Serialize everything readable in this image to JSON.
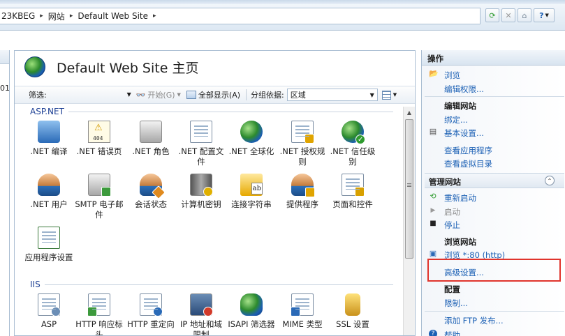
{
  "breadcrumb": {
    "items": [
      "23KBEG",
      "网站",
      "Default Web Site"
    ],
    "separator": "▸"
  },
  "toolbar": {
    "help_label": "?"
  },
  "left_panel": {
    "cut_text": "01"
  },
  "main": {
    "title": "Default Web Site 主页",
    "filter": {
      "label": "筛选:",
      "go_label": "开始(G)",
      "show_all_label": "全部显示(A)",
      "group_by_label": "分组依据:",
      "group_by_value": "区域"
    },
    "groups": [
      {
        "name": "ASP.NET",
        "tiles": [
          {
            "label": ".NET 编译",
            "icon": "download-arrow-icon"
          },
          {
            "label": ".NET 错误页",
            "icon": "error-404-icon"
          },
          {
            "label": ".NET 角色",
            "icon": "roles-icon"
          },
          {
            "label": ".NET 配置文件",
            "icon": "profile-icon"
          },
          {
            "label": ".NET 全球化",
            "icon": "globe-icon"
          },
          {
            "label": ".NET 授权规则",
            "icon": "authorization-icon"
          },
          {
            "label": ".NET 信任级别",
            "icon": "trust-level-icon"
          },
          {
            "label": ".NET 用户",
            "icon": "users-icon"
          },
          {
            "label": "SMTP 电子邮件",
            "icon": "smtp-email-icon"
          },
          {
            "label": "会话状态",
            "icon": "session-state-icon"
          },
          {
            "label": "计算机密钥",
            "icon": "machine-key-icon"
          },
          {
            "label": "连接字符串",
            "icon": "connection-string-icon"
          },
          {
            "label": "提供程序",
            "icon": "providers-icon"
          },
          {
            "label": "页面和控件",
            "icon": "pages-controls-icon"
          },
          {
            "label": "应用程序设置",
            "icon": "app-settings-icon"
          }
        ]
      },
      {
        "name": "IIS",
        "tiles": [
          {
            "label": "ASP",
            "icon": "asp-icon"
          },
          {
            "label": "HTTP 响应标头",
            "icon": "http-headers-icon"
          },
          {
            "label": "HTTP 重定向",
            "icon": "http-redirect-icon"
          },
          {
            "label": "IP 地址和域限制",
            "icon": "ip-restrictions-icon"
          },
          {
            "label": "ISAPI 筛选器",
            "icon": "isapi-filter-icon"
          },
          {
            "label": "MIME 类型",
            "icon": "mime-types-icon"
          },
          {
            "label": "SSL 设置",
            "icon": "ssl-lock-icon"
          }
        ]
      }
    ]
  },
  "actions": {
    "header": "操作",
    "items": [
      {
        "text": "浏览",
        "kind": "link",
        "icon": "explore-icon"
      },
      {
        "text": "编辑权限...",
        "kind": "link"
      },
      {
        "text": "编辑网站",
        "kind": "section"
      },
      {
        "text": "绑定...",
        "kind": "link"
      },
      {
        "text": "基本设置...",
        "kind": "link",
        "icon": "settings-icon"
      },
      {
        "text": "查看应用程序",
        "kind": "link"
      },
      {
        "text": "查看虚拟目录",
        "kind": "link"
      },
      {
        "text": "管理网站",
        "kind": "sectionbar"
      },
      {
        "text": "重新启动",
        "kind": "link",
        "icon": "restart-icon"
      },
      {
        "text": "启动",
        "kind": "dim",
        "icon": "start-icon"
      },
      {
        "text": "停止",
        "kind": "link",
        "icon": "stop-icon"
      },
      {
        "text": "浏览网站",
        "kind": "section"
      },
      {
        "text": "浏览 *:80 (http)",
        "kind": "link",
        "icon": "browse-icon"
      },
      {
        "text": "高级设置...",
        "kind": "link"
      },
      {
        "text": "配置",
        "kind": "section"
      },
      {
        "text": "限制...",
        "kind": "link"
      },
      {
        "text": "添加 FTP 发布...",
        "kind": "link"
      },
      {
        "text": "帮助",
        "kind": "link",
        "icon": "help-icon"
      }
    ]
  },
  "colors": {
    "link": "#1a5fb4",
    "highlight": "#e0342c",
    "group_heading": "#1c3f94"
  }
}
